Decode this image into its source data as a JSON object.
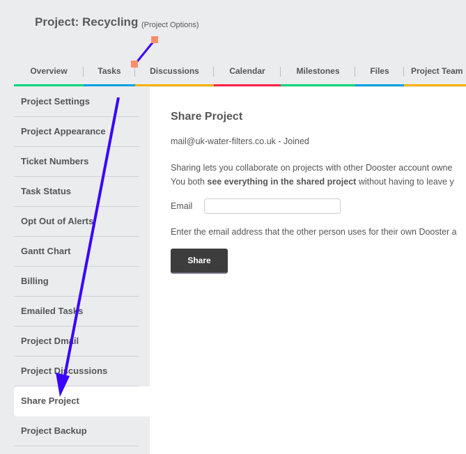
{
  "header": {
    "title": "Project: Recycling",
    "options_link": "(Project Options)"
  },
  "tabs": [
    {
      "label": "Overview",
      "color": "#00d67a"
    },
    {
      "label": "Tasks",
      "color": "#00a0e0"
    },
    {
      "label": "Discussions",
      "color": "#ffb000"
    },
    {
      "label": "Calendar",
      "color": "#ff2244"
    },
    {
      "label": "Milestones",
      "color": "#00d67a"
    },
    {
      "label": "Files",
      "color": "#00a0e0"
    },
    {
      "label": "Project Team",
      "color": "#ffb000"
    }
  ],
  "sidebar": {
    "items": [
      "Project Settings",
      "Project Appearance",
      "Ticket Numbers",
      "Task Status",
      "Opt Out of Alerts",
      "Gantt Chart",
      "Billing",
      "Emailed Tasks",
      "Project Dmail",
      "Project Discussions",
      "Share Project",
      "Project Backup"
    ],
    "active": "Share Project"
  },
  "main": {
    "heading": "Share Project",
    "shared_with": "mail@uk-water-filters.co.uk - Joined",
    "desc_line1": "Sharing lets you collaborate on projects with other Dooster account owne",
    "desc_line2_pre": "You both ",
    "desc_line2_bold": "see everything in the shared project",
    "desc_line2_post": " without having to leave y",
    "email_label": "Email",
    "email_value": "",
    "hint": "Enter the email address that the other person uses for their own Dooster a",
    "share_button": "Share"
  }
}
